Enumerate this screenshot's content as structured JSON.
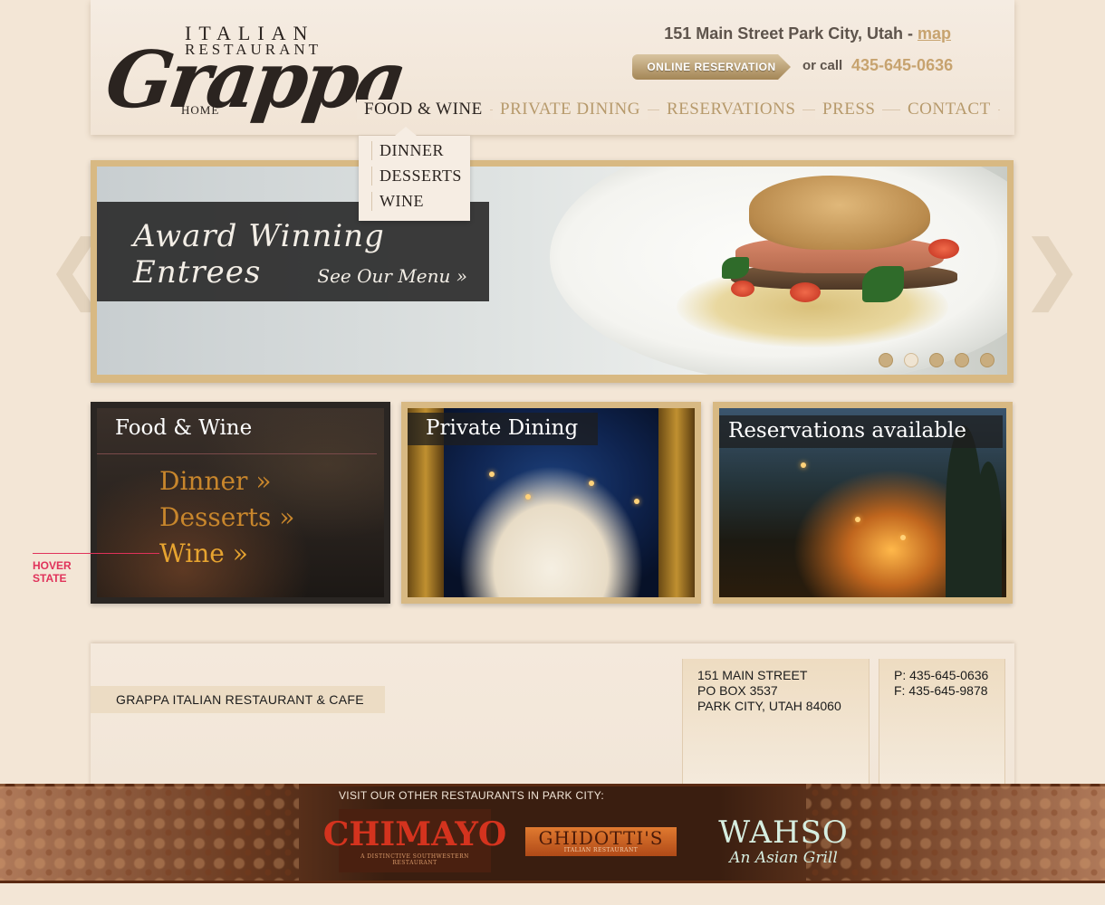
{
  "header": {
    "logo": {
      "top": "ITALIAN",
      "mid": "RESTAURANT",
      "script": "Grappa"
    },
    "home_label": "HOME",
    "address": "151 Main Street Park City, Utah -",
    "map_label": "map",
    "reservation_button": "ONLINE RESERVATION",
    "or_call": "or call",
    "phone": "435-645-0636"
  },
  "nav": {
    "items": [
      {
        "label": "FOOD & WINE"
      },
      {
        "label": "PRIVATE DINING"
      },
      {
        "label": "RESERVATIONS"
      },
      {
        "label": "PRESS"
      },
      {
        "label": "CONTACT"
      }
    ],
    "active_index": 0
  },
  "dropdown": {
    "items": [
      "DINNER",
      "DESSERTS",
      "WINE"
    ]
  },
  "slider": {
    "title": "Award Winning Entrees",
    "link": "See Our Menu »",
    "dot_count": 5,
    "active_dot": 1
  },
  "features": {
    "food_wine": {
      "title": "Food & Wine",
      "links": [
        "Dinner »",
        "Desserts »",
        "Wine »"
      ]
    },
    "private_dining": {
      "title": "Private Dining"
    },
    "reservations": {
      "title": "Reservations available"
    }
  },
  "hover_note": {
    "line1": "HOVER",
    "line2": "STATE"
  },
  "footer": {
    "name": "GRAPPA ITALIAN RESTAURANT & CAFE",
    "address_lines": [
      "151 MAIN STREET",
      "PO BOX 3537",
      "PARK CITY, UTAH  84060"
    ],
    "contact_lines": [
      "P: 435-645-0636",
      "F: 435-645-9878"
    ]
  },
  "band": {
    "visit_label": "VISIT OUR OTHER RESTAURANTS IN PARK CITY:",
    "chimayo": {
      "name": "CHIMAYO",
      "tagline": "A DISTINCTIVE SOUTHWESTERN RESTAURANT"
    },
    "ghidotti": {
      "name": "GHIDOTTI'S",
      "tagline": "ITALIAN RESTAURANT"
    },
    "wahso": {
      "name": "WAHSO",
      "tagline": "An Asian Grill"
    }
  },
  "colors": {
    "page_bg": "#f3e6d6",
    "gold_accent": "#c7a36f",
    "frame_gold": "#d8b983",
    "hover_link": "#e7a430",
    "annotation": "#e0325a"
  },
  "icons": [
    "chevron-left-icon",
    "chevron-right-icon"
  ]
}
